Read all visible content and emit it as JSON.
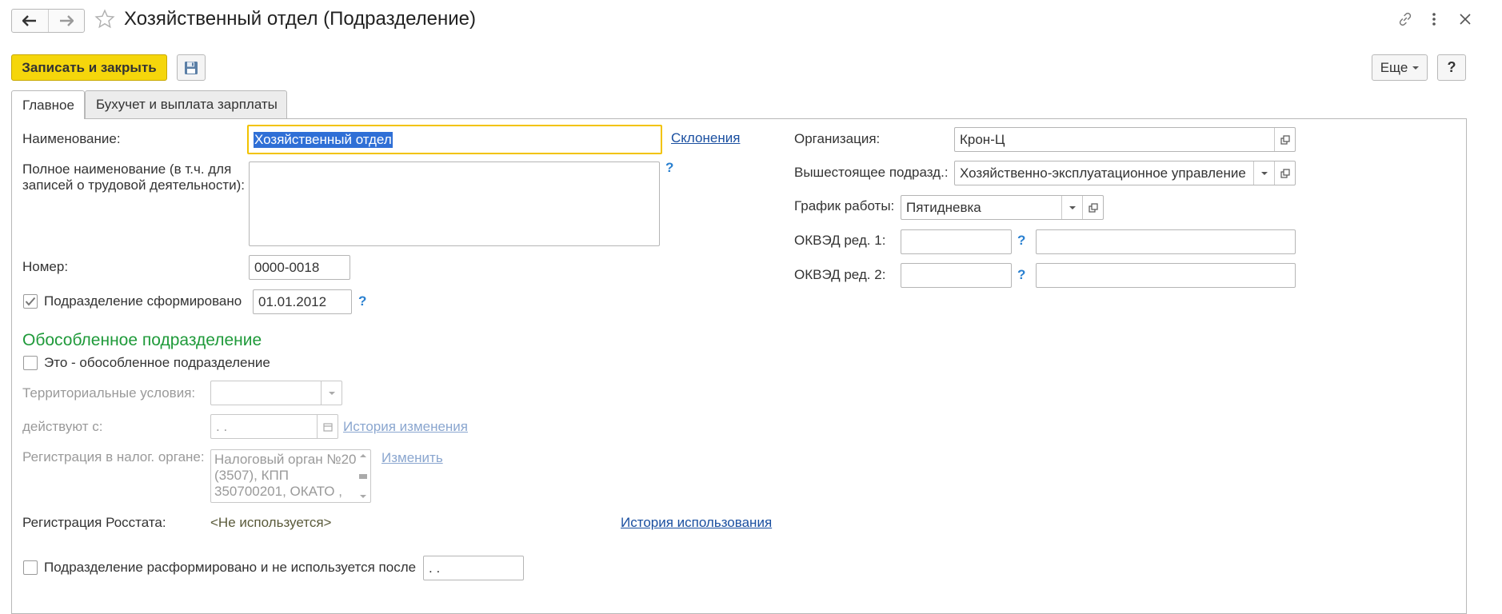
{
  "window": {
    "title": "Хозяйственный отдел (Подразделение)"
  },
  "toolbar": {
    "save_close_label": "Записать и закрыть",
    "more_label": "Еще",
    "help_label": "?"
  },
  "tabs": [
    {
      "label": "Главное",
      "active": true
    },
    {
      "label": "Бухучет и выплата зарплаты",
      "active": false
    }
  ],
  "form": {
    "name": {
      "label": "Наименование:",
      "value": "Хозяйственный отдел",
      "link": "Склонения"
    },
    "full_name": {
      "label_line1": "Полное наименование (в т.ч. для",
      "label_line2": "записей о трудовой деятельности):",
      "value": "",
      "help": "?"
    },
    "number": {
      "label": "Номер:",
      "value": "0000-0018"
    },
    "formed": {
      "label": "Подразделение сформировано",
      "checked": true,
      "date": "01.01.2012",
      "help": "?"
    },
    "organization": {
      "label": "Организация:",
      "value": "Крон-Ц"
    },
    "parent": {
      "label": "Вышестоящее подразд.:",
      "value": "Хозяйственно-эксплуатационное управление"
    },
    "schedule": {
      "label": "График работы:",
      "value": "Пятидневка"
    },
    "okved1": {
      "label": "ОКВЭД ред. 1:",
      "code": "",
      "help": "?",
      "name": ""
    },
    "okved2": {
      "label": "ОКВЭД ред. 2:",
      "code": "",
      "help": "?",
      "name": ""
    }
  },
  "separate": {
    "title": "Обособленное подразделение",
    "is_separate": {
      "label": "Это - обособленное подразделение",
      "checked": false
    },
    "territorial": {
      "label": "Территориальные условия:",
      "value": ""
    },
    "valid_from": {
      "label": "действуют с:",
      "value": " .  .",
      "link": "История изменения"
    },
    "tax_reg": {
      "label": "Регистрация в налог. органе:",
      "lines": [
        "Налоговый орган №20",
        "(3507), КПП",
        "350700201, ОКАТО ,"
      ],
      "link": "Изменить"
    },
    "rosstat": {
      "label": "Регистрация Росстата:",
      "value": "<Не используется>",
      "link": "История использования"
    },
    "disbanded": {
      "label": "Подразделение расформировано и не используется после",
      "checked": false,
      "date": " .  ."
    }
  },
  "colors": {
    "primary_button": "#f5d60b",
    "group_title": "#1f9a3a",
    "link": "#1a4fa0",
    "focus_border": "#f2c300",
    "selection": "#2f6fd6"
  }
}
